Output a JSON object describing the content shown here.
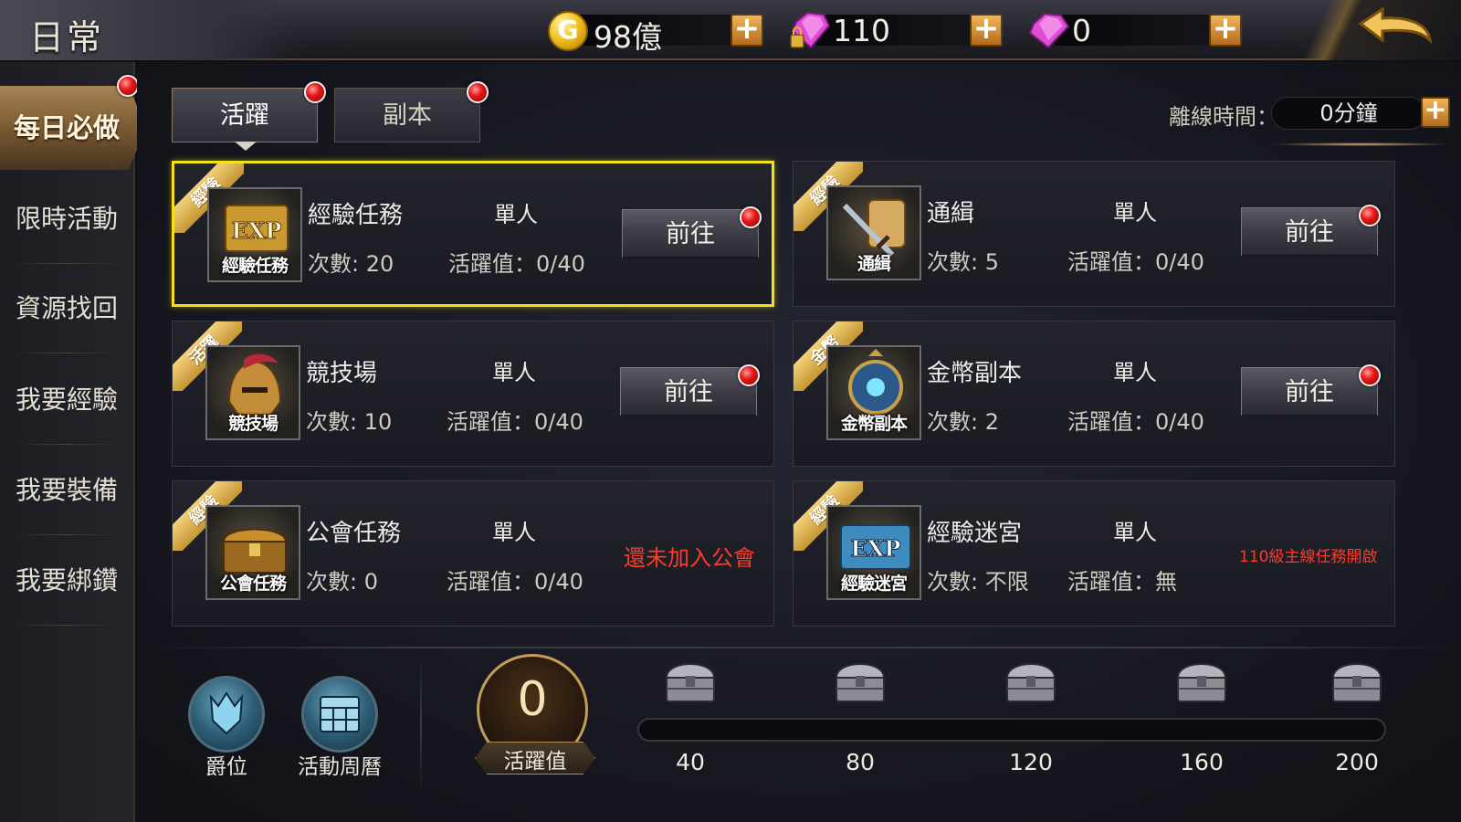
{
  "header": {
    "title": "日常",
    "gold": {
      "icon": "gold-coin-icon",
      "glyph": "G",
      "value": "98億"
    },
    "bound_diamond": {
      "icon": "locked-diamond-icon",
      "value": "110"
    },
    "diamond": {
      "icon": "diamond-icon",
      "value": "0"
    },
    "plus_glyph": "+",
    "back_icon": "back-arrow-icon"
  },
  "sidebar": {
    "items": [
      {
        "label": "每日必做",
        "active": true
      },
      {
        "label": "限時活動"
      },
      {
        "label": "資源找回"
      },
      {
        "label": "我要經驗"
      },
      {
        "label": "我要裝備"
      },
      {
        "label": "我要綁鑽"
      }
    ]
  },
  "tabs": [
    {
      "label": "活躍",
      "active": true
    },
    {
      "label": "副本"
    }
  ],
  "offline": {
    "label": "離線時間：",
    "value": "0分鐘",
    "plus": "+"
  },
  "tasks": [
    {
      "ribbon": "經驗",
      "icon_caption": "經驗任務",
      "icon": "exp-scroll-icon",
      "name": "經驗任務",
      "type": "單人",
      "count": "次數: 20",
      "active": "活躍值：0/40",
      "button": "前往"
    },
    {
      "ribbon": "經驗",
      "icon_caption": "通緝",
      "icon": "wanted-sword-icon",
      "name": "通緝",
      "type": "單人",
      "count": "次數: 5",
      "active": "活躍值：0/40",
      "button": "前往"
    },
    {
      "ribbon": "活躍",
      "icon_caption": "競技場",
      "icon": "arena-helmet-icon",
      "name": "競技場",
      "type": "單人",
      "count": "次數: 10",
      "active": "活躍值：0/40",
      "button": "前往"
    },
    {
      "ribbon": "金幣",
      "icon_caption": "金幣副本",
      "icon": "gold-dungeon-icon",
      "name": "金幣副本",
      "type": "單人",
      "count": "次數: 2",
      "active": "活躍值：0/40",
      "button": "前往"
    },
    {
      "ribbon": "經驗",
      "icon_caption": "公會任務",
      "icon": "guild-chest-icon",
      "name": "公會任務",
      "type": "單人",
      "count": "次數: 0",
      "active": "活躍值：0/40",
      "status": "還未加入公會"
    },
    {
      "ribbon": "經驗",
      "icon_caption": "經驗迷宮",
      "icon": "exp-maze-icon",
      "name": "經驗迷宮",
      "type": "單人",
      "count": "次數: 不限",
      "active": "活躍值：無",
      "status": "110級主線任務開啟"
    }
  ],
  "bottom": {
    "rank": {
      "label": "爵位",
      "icon": "rank-crest-icon"
    },
    "calendar": {
      "label": "活動周曆",
      "icon": "calendar-icon"
    },
    "activity": {
      "value": "0",
      "label": "活躍值",
      "progress_fraction": 0
    },
    "milestones": [
      "40",
      "80",
      "120",
      "160",
      "200"
    ],
    "chest_icon": "silver-chest-icon"
  },
  "colors": {
    "accent_gold": "#c49d5a",
    "selected_border": "#f3e11a",
    "warning_red": "#ff3a2a",
    "ribbon_gold": "#d8ab45"
  }
}
